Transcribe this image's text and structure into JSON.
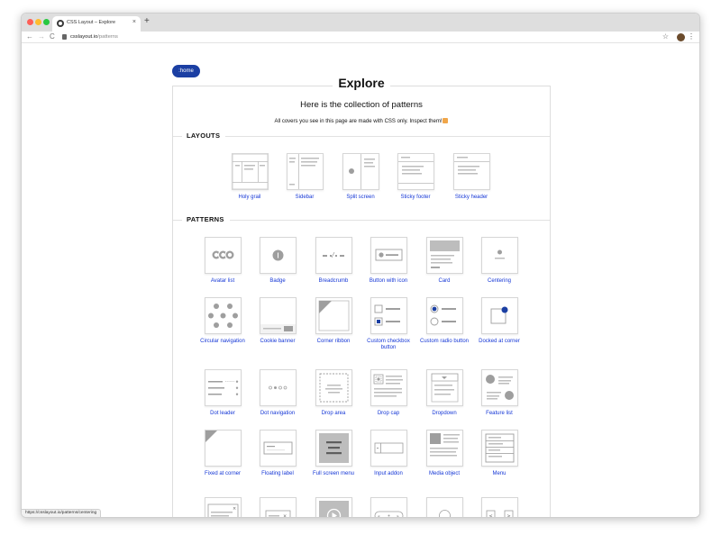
{
  "browser": {
    "tab_title": "CSS Layout – Explore",
    "tab_close": "×",
    "new_tab": "+",
    "back": "←",
    "forward": "→",
    "reload": "C",
    "url_host": "csslayout.io",
    "url_path": "/patterns",
    "bookmark": "☆",
    "menu": "⋮",
    "status_url": "https://csslayout.io/patterns/centering"
  },
  "page": {
    "home_label": ":home",
    "title": "Explore",
    "subtitle": "Here is the collection of patterns",
    "intro": "All covers you see in this page are made with CSS only. Inspect them!"
  },
  "sections": {
    "layouts": {
      "label": "LAYOUTS",
      "items": [
        {
          "label": "Holy grail",
          "icon": "holy-grail"
        },
        {
          "label": "Sidebar",
          "icon": "sidebar"
        },
        {
          "label": "Split screen",
          "icon": "split-screen"
        },
        {
          "label": "Sticky footer",
          "icon": "sticky-footer"
        },
        {
          "label": "Sticky header",
          "icon": "sticky-header"
        }
      ]
    },
    "patterns": {
      "label": "PATTERNS",
      "items": [
        {
          "label": "Avatar list",
          "icon": "avatar-list"
        },
        {
          "label": "Badge",
          "icon": "badge"
        },
        {
          "label": "Breadcrumb",
          "icon": "breadcrumb"
        },
        {
          "label": "Button with icon",
          "icon": "button-with-icon"
        },
        {
          "label": "Card",
          "icon": "card"
        },
        {
          "label": "Centering",
          "icon": "centering"
        },
        {
          "label": "Circular navigation",
          "icon": "circular-navigation"
        },
        {
          "label": "Cookie banner",
          "icon": "cookie-banner"
        },
        {
          "label": "Corner ribbon",
          "icon": "corner-ribbon"
        },
        {
          "label": "Custom checkbox button",
          "icon": "custom-checkbox-button"
        },
        {
          "label": "Custom radio button",
          "icon": "custom-radio-button"
        },
        {
          "label": "Docked at corner",
          "icon": "docked-at-corner"
        },
        {
          "label": "Dot leader",
          "icon": "dot-leader"
        },
        {
          "label": "Dot navigation",
          "icon": "dot-navigation"
        },
        {
          "label": "Drop area",
          "icon": "drop-area"
        },
        {
          "label": "Drop cap",
          "icon": "drop-cap"
        },
        {
          "label": "Dropdown",
          "icon": "dropdown"
        },
        {
          "label": "Feature list",
          "icon": "feature-list"
        },
        {
          "label": "Fixed at corner",
          "icon": "fixed-at-corner"
        },
        {
          "label": "Floating label",
          "icon": "floating-label"
        },
        {
          "label": "Full screen menu",
          "icon": "full-screen-menu"
        },
        {
          "label": "Input addon",
          "icon": "input-addon"
        },
        {
          "label": "Media object",
          "icon": "media-object"
        },
        {
          "label": "Menu",
          "icon": "menu"
        },
        {
          "label": "",
          "icon": "modal"
        },
        {
          "label": "",
          "icon": "notification"
        },
        {
          "label": "",
          "icon": "overlay-play-button"
        },
        {
          "label": "",
          "icon": "pagination"
        },
        {
          "label": "",
          "icon": "popover-arrow"
        },
        {
          "label": "",
          "icon": "previous-next-buttons"
        }
      ]
    }
  },
  "colors": {
    "accent": "#1b3fa3",
    "link": "#1537d6",
    "placeholder_gray": "#bdbdbd",
    "checked_blue": "#1b3fa3"
  }
}
